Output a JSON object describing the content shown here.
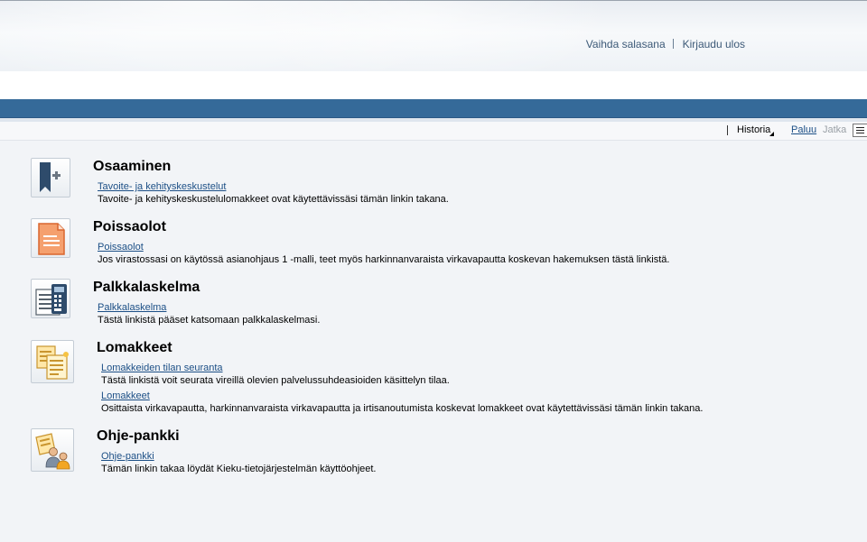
{
  "header": {
    "change_password": "Vaihda salasana",
    "logout": "Kirjaudu ulos"
  },
  "toolbar": {
    "history": "Historia",
    "back": "Paluu",
    "forward": "Jatka"
  },
  "sections": [
    {
      "title": "Osaaminen",
      "icon": "bookmark-add-icon",
      "links": [
        {
          "label": "Tavoite- ja kehityskeskustelut",
          "description": "Tavoite- ja kehityskeskustelulomakkeet ovat käytettävissäsi tämän linkin takana."
        }
      ]
    },
    {
      "title": "Poissaolot",
      "icon": "document-icon",
      "links": [
        {
          "label": "Poissaolot",
          "description": "Jos virastossasi on käytössä asianohjaus 1 -malli, teet myös harkinnanvaraista virkavapautta koskevan hakemuksen tästä linkistä."
        }
      ]
    },
    {
      "title": "Palkkalaskelma",
      "icon": "payslip-calculator-icon",
      "links": [
        {
          "label": "Palkkalaskelma",
          "description": "Tästä linkistä pääset katsomaan palkkalaskelmasi."
        }
      ]
    },
    {
      "title": "Lomakkeet",
      "icon": "forms-icon",
      "links": [
        {
          "label": "Lomakkeiden tilan seuranta",
          "description": "Tästä linkistä voit seurata vireillä olevien palvelussuhdeasioiden käsittelyn tilaa."
        },
        {
          "label": "Lomakkeet",
          "description": "Osittaista virkavapautta, harkinnanvaraista virkavapautta ja irtisanoutumista koskevat lomakkeet ovat käytettävissäsi tämän linkin takana."
        }
      ]
    },
    {
      "title": "Ohje-pankki",
      "icon": "help-people-icon",
      "links": [
        {
          "label": "Ohje-pankki",
          "description": "Tämän linkin takaa löydät Kieku-tietojärjestelmän käyttöohjeet."
        }
      ]
    }
  ]
}
